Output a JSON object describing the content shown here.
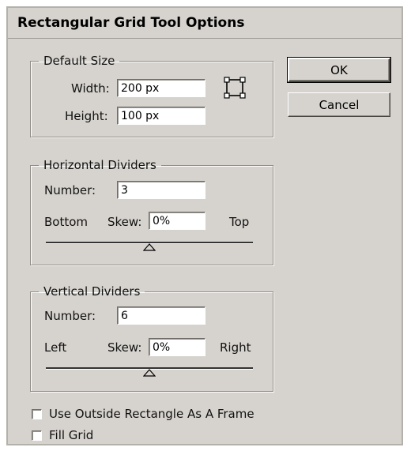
{
  "dialog": {
    "title": "Rectangular Grid Tool Options"
  },
  "default_size": {
    "legend": "Default Size",
    "width_label": "Width:",
    "width_value": "200 px",
    "height_label": "Height:",
    "height_value": "100 px"
  },
  "horizontal": {
    "legend": "Horizontal Dividers",
    "number_label": "Number:",
    "number_value": "3",
    "left_end": "Bottom",
    "skew_label": "Skew:",
    "skew_value": "0%",
    "right_end": "Top",
    "skew_position": 0.5
  },
  "vertical": {
    "legend": "Vertical Dividers",
    "number_label": "Number:",
    "number_value": "6",
    "left_end": "Left",
    "skew_label": "Skew:",
    "skew_value": "0%",
    "right_end": "Right",
    "skew_position": 0.5
  },
  "options": {
    "use_outside_label": "Use Outside Rectangle As A Frame",
    "use_outside_checked": false,
    "fill_grid_label": "Fill Grid",
    "fill_grid_checked": false
  },
  "buttons": {
    "ok": "OK",
    "cancel": "Cancel"
  },
  "icons": {
    "reference_point": "reference-point-icon",
    "slider_thumb": "triangle-up-icon"
  }
}
